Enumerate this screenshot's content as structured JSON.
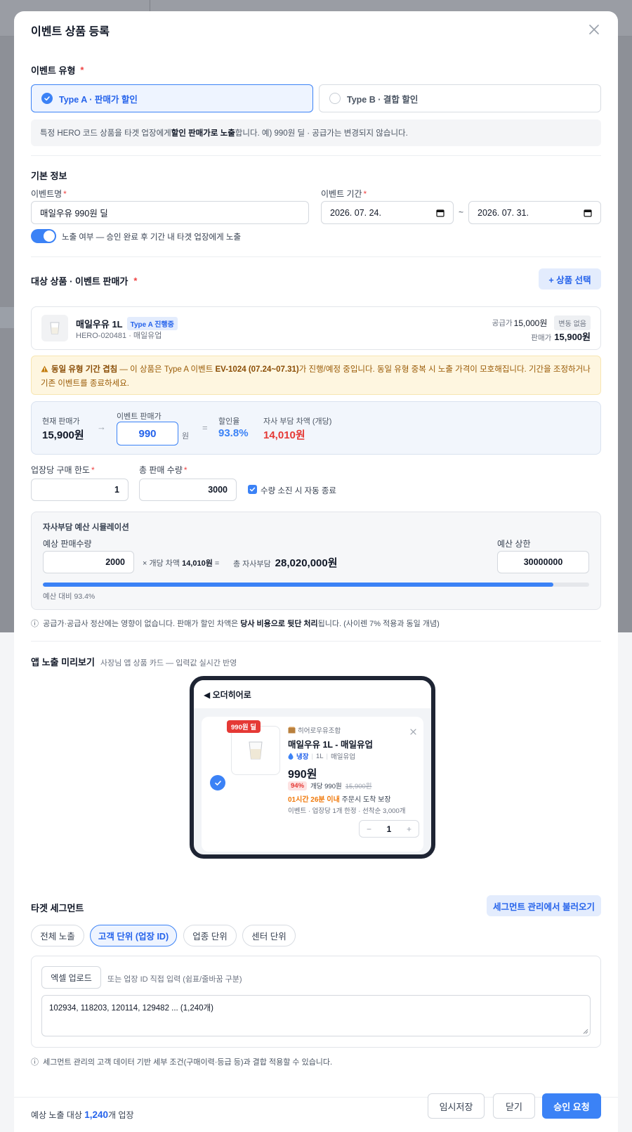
{
  "modal": {
    "title": "이벤트 상품 등록"
  },
  "event_type": {
    "label": "이벤트 유형",
    "required_mark": "*",
    "options": [
      {
        "label": "Type A · 판매가 할인",
        "selected": true
      },
      {
        "label": "Type B · 결합 할인",
        "selected": false
      }
    ],
    "info_pre": "특정 HERO 코드 상품을 타겟 업장에게 ",
    "info_bold": "할인 판매가로 노출",
    "info_post": "합니다. 예) 990원 딜 · 공급가는 변경되지 않습니다."
  },
  "basic": {
    "title": "기본 정보",
    "name_label": "이벤트명",
    "name_value": "매일우유 990원 딜",
    "period_label": "이벤트 기간",
    "start_date": "2026. 07. 24.",
    "end_date": "2026. 07. 31.",
    "tilde": "~",
    "toggle_on": true,
    "toggle_text": "노출 여부 — 승인 완료 후 기간 내 타겟 업장에게 노출"
  },
  "target_product": {
    "title": "대상 상품 · 이벤트 판매가",
    "select_button": "+ 상품 선택",
    "product": {
      "name": "매일우유 1L",
      "badge": "Type A 진행중",
      "code": "HERO-020481 · 매일유업",
      "supply_label": "공급가",
      "supply_value": "15,000원",
      "supply_badge": "변동 없음",
      "sale_label": "판매가",
      "sale_value": "15,900원"
    },
    "warning": {
      "bold": "동일 유형 기간 겹침",
      "text1": " — 이 상품은 Type A 이벤트 ",
      "event_ref": "EV-1024 (07.24~07.31)",
      "text2": "가 진행/예정 중입니다. 동일 유형 중복 시 노출 가격이 모호해집니다. 기간을 조정하거나 기존 이벤트를 종료하세요."
    },
    "calc": {
      "current_label": "현재 판매가",
      "current_value": "15,900원",
      "arrow": "→",
      "event_label": "이벤트 판매가",
      "event_value": "990",
      "event_unit": "원",
      "equals": "=",
      "discount_label": "할인율",
      "discount_value": "93.8%",
      "burden_label": "자사 부담 차액 (개당)",
      "burden_value": "14,010원"
    },
    "limit_label": "업장당 구매 한도",
    "limit_value": "1",
    "total_label": "총 판매 수량",
    "total_value": "3000",
    "auto_end_checked": true,
    "auto_end_text": "수량 소진 시 자동 종료"
  },
  "simulation": {
    "title": "자사부담 예산 시뮬레이션",
    "expected_label": "예상 판매수량",
    "expected_value": "2000",
    "times_text": "× 개당 차액 ",
    "unit_diff": "14,010원",
    "eq_text": " =",
    "total_label": "총 자사부담",
    "total_value": "28,020,000원",
    "cap_label": "예산 상한",
    "cap_value": "30000000",
    "progress_pct": 93.4,
    "progress_text": "예산 대비 93.4%"
  },
  "settlement_note": {
    "icon": "ⓘ",
    "pre": "공급가·공급사 정산에는 영향이 없습니다. 판매가 할인 차액은 ",
    "bold": "당사 비용으로 뒷단 처리",
    "post": "됩니다. (사이렌 7% 적용과 동일 개념)"
  },
  "preview": {
    "title": "앱 노출 미리보기",
    "subtitle": "사장님 앱 상품 카드 — 입력값 실시간 반영",
    "app_back": "◀ 오더히어로",
    "deal_badge": "990원 딜",
    "seller": "히어로우유조합",
    "product_title": "매일우유 1L - 매일유업",
    "storage": "냉장",
    "size": "1L",
    "brand": "매일유업",
    "price": "990원",
    "discount": "94%",
    "unit_price": "개당 990원",
    "orig_price": "15,900원",
    "delivery_time": "01시간 26분 이내",
    "delivery_text": " 주문시 도착 보장",
    "limit_text": "이벤트 · 업장당 1개 한정 · 선착순 3,000개",
    "qty": "1",
    "minus": "−",
    "plus": "+"
  },
  "segment": {
    "title": "타겟 세그먼트",
    "load_button": "세그먼트 관리에서 불러오기",
    "tabs": [
      {
        "label": "전체 노출",
        "active": false
      },
      {
        "label": "고객 단위 (업장 ID)",
        "active": true
      },
      {
        "label": "업종 단위",
        "active": false
      },
      {
        "label": "센터 단위",
        "active": false
      }
    ],
    "upload_button": "엑셀 업로드",
    "upload_hint": "또는 업장 ID 직접 입력 (쉼표/줄바꿈 구분)",
    "ids_text": "102934, 118203, 120114, 129482 ... (1,240개)",
    "note": "세그먼트 관리의 고객 데이터 기반 세부 조건(구매이력·등급 등)과 결합 적용할 수 있습니다."
  },
  "footer": {
    "reach_pre": "예상 노출 대상 ",
    "reach_count": "1,240",
    "reach_post": "개 업장",
    "save_draft": "임시저장",
    "close": "닫기",
    "submit": "승인 요청"
  },
  "colors": {
    "primary": "#3b82f6",
    "danger": "#e53935",
    "warning_bg": "#fef6e0"
  }
}
